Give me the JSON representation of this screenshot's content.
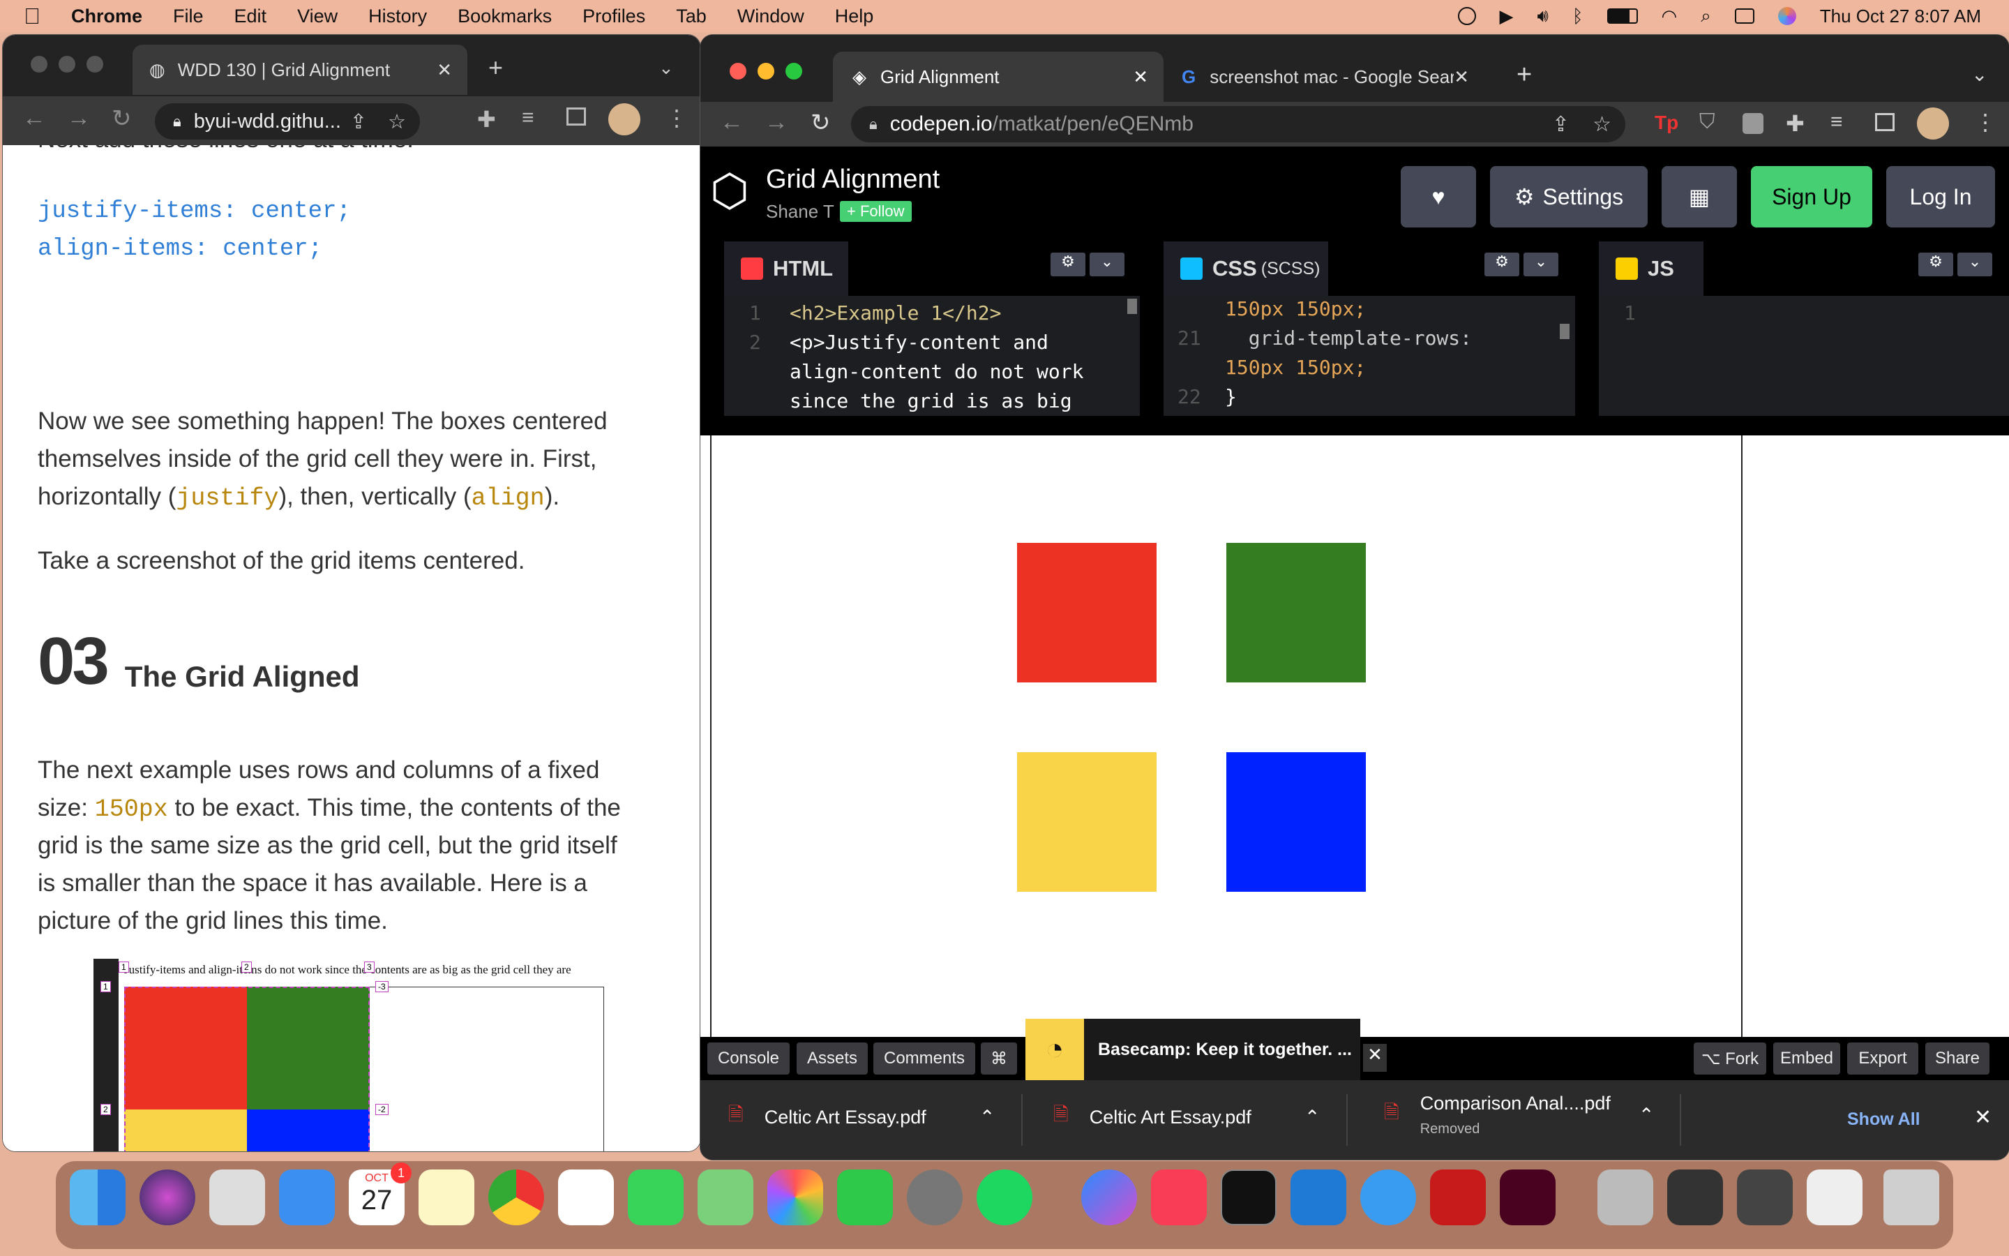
{
  "menubar": {
    "app": "Chrome",
    "items": [
      "File",
      "Edit",
      "View",
      "History",
      "Bookmarks",
      "Profiles",
      "Tab",
      "Window",
      "Help"
    ],
    "datetime": "Thu Oct 27  8:07 AM"
  },
  "left_window": {
    "tab_title": "WDD 130 | Grid Alignment",
    "url": "byui-wdd.githu...",
    "cut_top_text": "Next add these lines one at a time:",
    "code_line1": "justify-items: center;",
    "code_line2": "align-items: center;",
    "para1_a": "Now we see something happen! The boxes centered",
    "para1_b": "themselves inside of the grid cell they were in. First,",
    "para1_c1": "horizontally (",
    "para1_code1": "justify",
    "para1_c2": "), then, vertically (",
    "para1_code2": "align",
    "para1_c3": ").",
    "para2": "Take a screenshot of the grid items centered.",
    "section_number": "03",
    "section_title": "The Grid Aligned",
    "para3_a1": "The next example uses rows and columns of a fixed",
    "para3_b1": "size: ",
    "para3_code": "150px",
    "para3_b2": " to be exact. This time, the contents of the",
    "para3_c": "grid is the same size as the grid cell, but the grid itself",
    "para3_d": "is smaller than the space it has available. Here is a",
    "para3_e": "picture of the grid lines this time.",
    "figure_caption": "Justify-items and align-items do not work since the contents are as big as the grid cell they are",
    "figure_labels": [
      "1",
      "2",
      "3",
      "-3",
      "1",
      "2",
      "-2"
    ]
  },
  "right_window": {
    "tabs": [
      {
        "title": "Grid Alignment",
        "active": true
      },
      {
        "title": "screenshot mac - Google Searc",
        "active": false
      }
    ],
    "url_host": "codepen.io",
    "url_path": "/matkat/pen/eQENmb",
    "pen_title": "Grid Alignment",
    "author": "Shane T",
    "follow": "+ Follow",
    "settings": "Settings",
    "signup": "Sign Up",
    "login": "Log In",
    "html_label": "HTML",
    "css_label": "CSS",
    "css_sub": "(SCSS)",
    "js_label": "JS",
    "html_code": [
      {
        "n": "1",
        "text": "<h2>Example 1</h2>"
      },
      {
        "n": "2",
        "text": "<p>Justify-content and"
      },
      {
        "n": "",
        "text": "align-content do not work"
      },
      {
        "n": "",
        "text": "since the grid is as big"
      }
    ],
    "css_code": [
      {
        "n": "",
        "text": "150px 150px;"
      },
      {
        "n": "21",
        "text": "  grid-template-rows:"
      },
      {
        "n": "",
        "text": "150px 150px;"
      },
      {
        "n": "22",
        "text": "}"
      }
    ],
    "js_code": [
      {
        "n": "1",
        "text": ""
      }
    ],
    "boxes": [
      "#ec3323",
      "#347d20",
      "#f9d448",
      "#0022ff"
    ],
    "bottom_left": [
      "Console",
      "Assets",
      "Comments",
      "⌘"
    ],
    "ad_text": "Basecamp: Keep it together. ...",
    "bottom_right": [
      "⌥ Fork",
      "Embed",
      "Export",
      "Share"
    ]
  },
  "downloads": {
    "items": [
      {
        "name": "Celtic Art Essay.pdf",
        "status": ""
      },
      {
        "name": "Celtic Art Essay.pdf",
        "status": ""
      },
      {
        "name": "Comparison Anal....pdf",
        "status": "Removed"
      }
    ],
    "show_all": "Show All"
  },
  "dock": {
    "calendar_month": "OCT",
    "calendar_day": "27",
    "badge": "1"
  }
}
